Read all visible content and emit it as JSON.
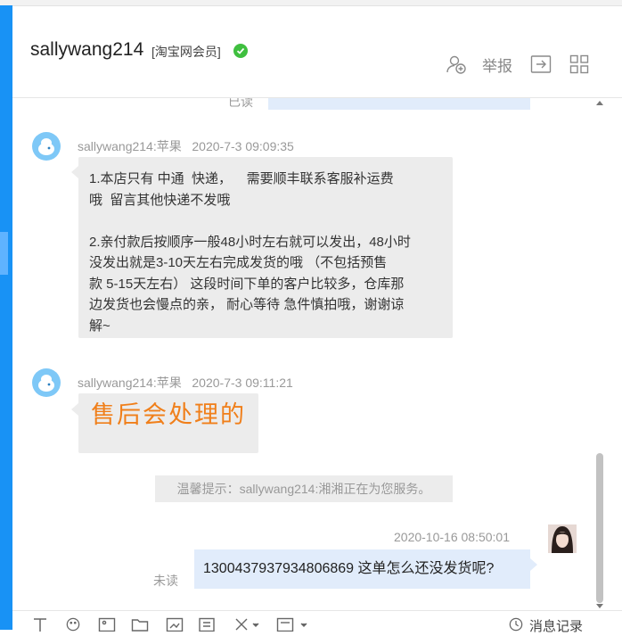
{
  "header": {
    "username": "sallywang214",
    "badge": "[淘宝网会员]",
    "report_label": "举报"
  },
  "chat": {
    "partial_read_status": "已读",
    "messages": [
      {
        "meta": "sallywang214:苹果   2020-7-3 09:09:35",
        "text": "1.本店只有 中通  快递，    需要顺丰联系客服补运费\n哦  留言其他快递不发哦\n\n2.亲付款后按顺序一般48小时左右就可以发出，48小时\n没发出就是3-10天左右完成发货的哦 （不包括预售\n款 5-15天左右） 这段时间下单的客户比较多，仓库那\n边发货也会慢点的亲， 耐心等待 急件慎拍哦，谢谢谅\n解~"
      },
      {
        "meta": "sallywang214:苹果   2020-7-3 09:11:21",
        "text": "售后会处理的"
      }
    ],
    "system_tip": "温馨提示：sallywang214:湘湘正在为您服务。",
    "my_message": {
      "time": "2020-10-16 08:50:01",
      "text": "1300437937934806869 这单怎么还没发货呢?",
      "status": "未读"
    }
  },
  "toolbar": {
    "history_label": "消息记录"
  },
  "colors": {
    "accent_blue": "#1892f5",
    "verified_green": "#3fbf3f",
    "handwriting_orange": "#f07f1a",
    "my_bubble": "#e1ecfb",
    "other_bubble": "#ececec"
  }
}
